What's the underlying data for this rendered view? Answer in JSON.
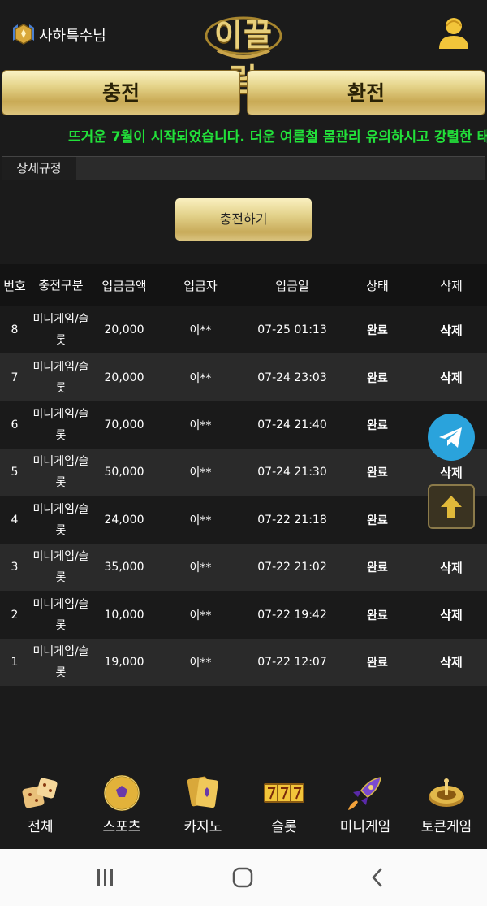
{
  "header": {
    "user_name": "사하특수님",
    "logo_text": "이끌림"
  },
  "buttons": {
    "deposit": "충전",
    "withdraw": "환전",
    "charge_action": "충전하기"
  },
  "notice": "뜨거운 7월이 시작되었습니다. 더운 여름철 몸관리 유의하시고 강렬한 태",
  "tabs": {
    "rules": "상세규정"
  },
  "table": {
    "headers": {
      "no": "번호",
      "type": "충전구분",
      "amount": "입금금액",
      "depositor": "입금자",
      "date": "입금일",
      "status": "상태",
      "delete": "삭제"
    },
    "rows": [
      {
        "no": "8",
        "type": "미니게임/슬롯",
        "amount": "20,000",
        "depositor": "이**",
        "date": "07-25 01:13",
        "status": "완료",
        "delete": "삭제"
      },
      {
        "no": "7",
        "type": "미니게임/슬롯",
        "amount": "20,000",
        "depositor": "이**",
        "date": "07-24 23:03",
        "status": "완료",
        "delete": "삭제"
      },
      {
        "no": "6",
        "type": "미니게임/슬롯",
        "amount": "70,000",
        "depositor": "이**",
        "date": "07-24 21:40",
        "status": "완료",
        "delete": ""
      },
      {
        "no": "5",
        "type": "미니게임/슬롯",
        "amount": "50,000",
        "depositor": "이**",
        "date": "07-24 21:30",
        "status": "완료",
        "delete": "삭제"
      },
      {
        "no": "4",
        "type": "미니게임/슬롯",
        "amount": "24,000",
        "depositor": "이**",
        "date": "07-22 21:18",
        "status": "완료",
        "delete": ""
      },
      {
        "no": "3",
        "type": "미니게임/슬롯",
        "amount": "35,000",
        "depositor": "이**",
        "date": "07-22 21:02",
        "status": "완료",
        "delete": "삭제"
      },
      {
        "no": "2",
        "type": "미니게임/슬롯",
        "amount": "10,000",
        "depositor": "이**",
        "date": "07-22 19:42",
        "status": "완료",
        "delete": "삭제"
      },
      {
        "no": "1",
        "type": "미니게임/슬롯",
        "amount": "19,000",
        "depositor": "이**",
        "date": "07-22 12:07",
        "status": "완료",
        "delete": "삭제"
      }
    ]
  },
  "fabs": {
    "telegram_icon": "telegram-icon",
    "scroll_top_icon": "arrow-up-icon"
  },
  "bottom_nav": [
    {
      "label": "전체",
      "icon": "dice-icon"
    },
    {
      "label": "스포츠",
      "icon": "soccer-ball-icon"
    },
    {
      "label": "카지노",
      "icon": "cards-icon"
    },
    {
      "label": "슬롯",
      "icon": "slot-777-icon"
    },
    {
      "label": "미니게임",
      "icon": "rocket-icon"
    },
    {
      "label": "토큰게임",
      "icon": "roulette-icon"
    }
  ],
  "system_nav": {
    "recents": "recents-icon",
    "home": "home-icon",
    "back": "back-icon"
  },
  "colors": {
    "gold": "#e3d28b",
    "notice_green": "#22e03a",
    "background": "#1b1b1b",
    "telegram": "#2aa3dc"
  }
}
